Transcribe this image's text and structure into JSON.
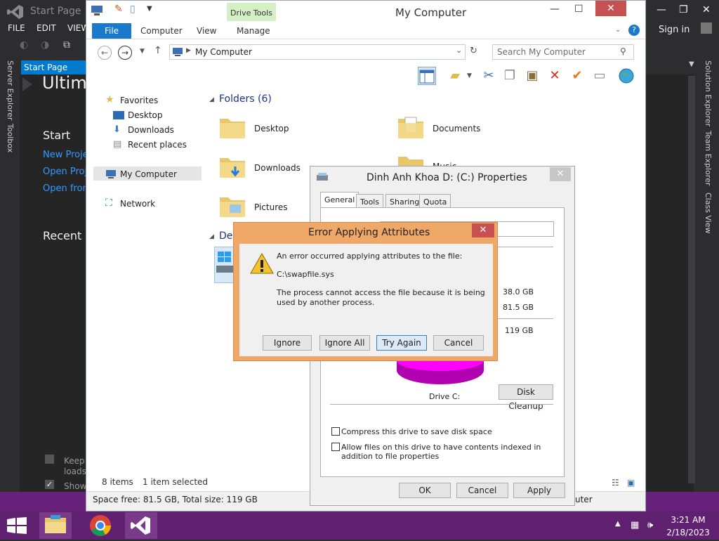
{
  "vs": {
    "window_title": "Start Page",
    "menu": [
      "FILE",
      "EDIT",
      "VIEW"
    ],
    "left_strip": [
      "Server Explorer",
      "Toolbox"
    ],
    "start_tab": "Start Page",
    "start_tab_pin": "⊣",
    "start_tab_close": "✕",
    "product": "Ultima",
    "start_heading": "Start",
    "start_links": [
      "New Proje",
      "Open Proje",
      "Open from"
    ],
    "recent_heading": "Recent",
    "keep_label": "Keep",
    "loads_label": "loads",
    "show_label": "Show",
    "sign_in": "Sign in",
    "right_strip": [
      "Solution Explorer",
      "Team Explorer",
      "Class View"
    ],
    "accent_color": "#007acc",
    "status_color": "#68217a"
  },
  "explorer": {
    "title": "My Computer",
    "contextual_tab": "Drive Tools",
    "ribbon_tabs": {
      "file": "File",
      "computer": "Computer",
      "view": "View",
      "manage": "Manage"
    },
    "address": "My Computer",
    "search_placeholder": "Search My Computer",
    "nav": {
      "favorites": "Favorites",
      "desktop": "Desktop",
      "downloads": "Downloads",
      "recent_places": "Recent places",
      "my_computer": "My Computer",
      "network": "Network"
    },
    "folders_header": "Folders (6)",
    "folders": {
      "desktop": "Desktop",
      "documents": "Documents",
      "downloads": "Downloads",
      "music": "Music",
      "pictures": "Pictures"
    },
    "devices_header": "Dev",
    "status_items": "8 items",
    "status_selected": "1 item selected",
    "details": "Space free: 81.5 GB, Total size: 119 GB",
    "details_right": "uter"
  },
  "properties": {
    "title": "Dinh Anh Khoa D: (C:) Properties",
    "tabs": [
      "General",
      "Tools",
      "Sharing",
      "Quota"
    ],
    "used_value": "38.0 GB",
    "free_value": "81.5 GB",
    "capacity_value": "119 GB",
    "drive_label": "Drive C:",
    "disk_cleanup": "Disk Cleanup",
    "compress_label": "Compress this drive to save disk space",
    "index_label": "Allow files on this drive to have contents indexed in addition to file properties",
    "ok": "OK",
    "cancel": "Cancel",
    "apply": "Apply",
    "pie_color": "#ff00ff"
  },
  "error": {
    "title": "Error Applying Attributes",
    "line1": "An error occurred applying attributes to the file:",
    "file": "C:\\swapfile.sys",
    "line2": "The process cannot access the file because it is being used by another process.",
    "buttons": {
      "ignore": "Ignore",
      "ignore_all": "Ignore All",
      "try_again": "Try Again",
      "cancel": "Cancel"
    },
    "frame_color": "#f0a868"
  },
  "taskbar": {
    "time": "3:21 AM",
    "date": "2/18/2023"
  }
}
